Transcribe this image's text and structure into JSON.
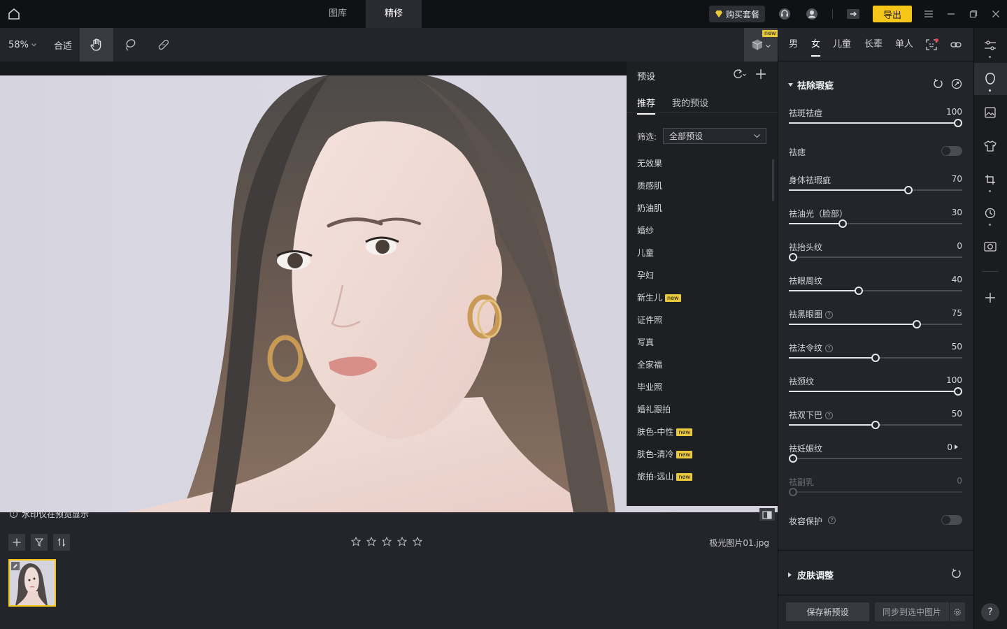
{
  "titlebar": {
    "tabs": [
      {
        "label": "图库"
      },
      {
        "label": "精修"
      }
    ],
    "buy_label": "购买套餐",
    "export_label": "导出"
  },
  "toolbar": {
    "zoom": "58%",
    "fit_label": "合适",
    "preset_new_badge": "new"
  },
  "presets": {
    "title": "预设",
    "tabs": [
      "推荐",
      "我的预设"
    ],
    "filter_label": "筛选:",
    "filter_value": "全部预设",
    "items": [
      {
        "label": "无效果",
        "new": ""
      },
      {
        "label": "质感肌",
        "new": ""
      },
      {
        "label": "奶油肌",
        "new": ""
      },
      {
        "label": "婚纱",
        "new": ""
      },
      {
        "label": "儿童",
        "new": ""
      },
      {
        "label": "孕妇",
        "new": ""
      },
      {
        "label": "新生儿",
        "new": "new"
      },
      {
        "label": "证件照",
        "new": ""
      },
      {
        "label": "写真",
        "new": ""
      },
      {
        "label": "全家福",
        "new": ""
      },
      {
        "label": "毕业照",
        "new": ""
      },
      {
        "label": "婚礼跟拍",
        "new": ""
      },
      {
        "label": "肤色-中性",
        "new": "new"
      },
      {
        "label": "肤色-清冷",
        "new": "new"
      },
      {
        "label": "旅拍-远山",
        "new": "new"
      }
    ]
  },
  "canvas": {
    "watermark_note": "水印仅在预览显示"
  },
  "right_panel": {
    "tabs": [
      "男",
      "女",
      "儿童",
      "长辈",
      "单人"
    ],
    "active_tab": "女",
    "section1_title": "祛除瑕疵",
    "section2_title": "皮肤调整",
    "sliders": [
      {
        "label": "祛斑祛痘",
        "value": 100,
        "help": false
      },
      {
        "label": "身体祛瑕疵",
        "value": 70,
        "help": false
      },
      {
        "label": "祛油光（脸部）",
        "value": 30,
        "help": false
      },
      {
        "label": "祛抬头纹",
        "value": 0,
        "help": false
      },
      {
        "label": "祛眼周纹",
        "value": 40,
        "help": false
      },
      {
        "label": "祛黑眼圈",
        "value": 75,
        "help": true
      },
      {
        "label": "祛法令纹",
        "value": 50,
        "help": true
      },
      {
        "label": "祛颈纹",
        "value": 100,
        "help": false
      },
      {
        "label": "祛双下巴",
        "value": 50,
        "help": true
      },
      {
        "label": "祛妊娠纹",
        "value": 0,
        "help": false
      },
      {
        "label": "祛副乳",
        "value": 0,
        "help": false
      }
    ],
    "toggles": [
      {
        "label": "祛痣",
        "on": false
      },
      {
        "label": "妆容保护",
        "on": false
      }
    ],
    "save_preset_label": "保存新预设",
    "sync_label": "同步到选中图片"
  },
  "bottom": {
    "filename": "极光图片01.jpg",
    "rating_stars": 5
  },
  "colors": {
    "accent_yellow": "#f5c518",
    "panel": "#24252a",
    "titlebar": "#101114"
  }
}
